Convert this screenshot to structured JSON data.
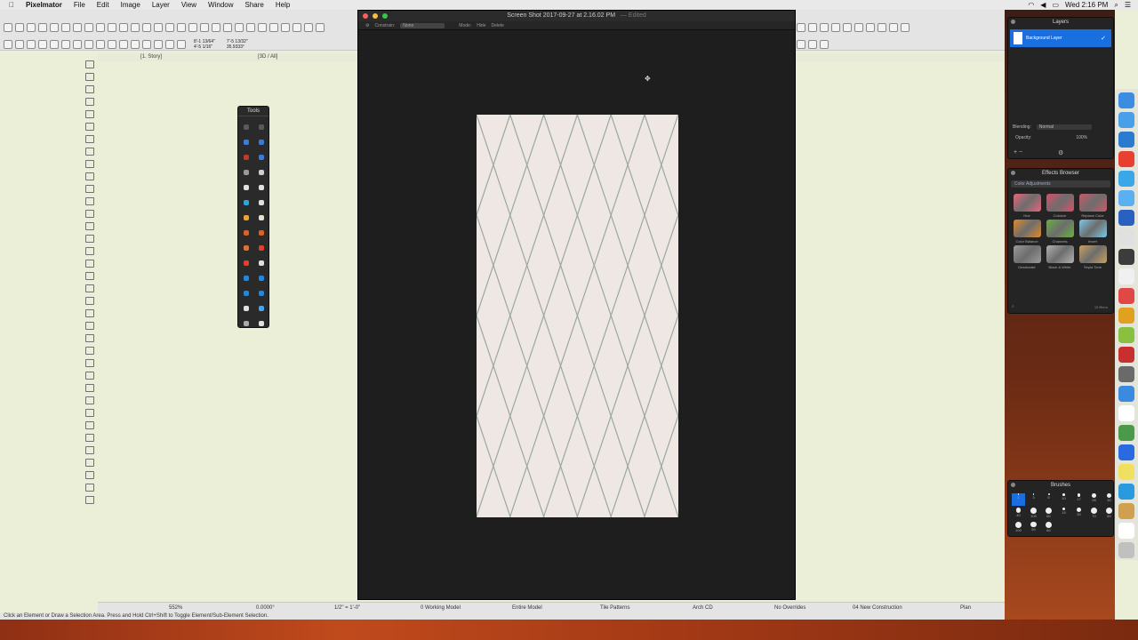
{
  "menubar": {
    "apple": "",
    "app_name": "Pixelmator",
    "menus": [
      "File",
      "Edit",
      "Image",
      "Layer",
      "View",
      "Window",
      "Share",
      "Help"
    ],
    "clock": "Wed 2:16 PM"
  },
  "archicad": {
    "coord_x1": "8'-1 13/64\"",
    "coord_y1": "4'-5 1/16\"",
    "coord_x2": "7'-5 13/32\"",
    "coord_angle": "35.9333°",
    "story_tab": "[1. Story]",
    "view_tab": "[3D / All]",
    "status_text": "Click an Element or Draw a Selection Area. Press and Hold Ctrl+Shift to Toggle Element/Sub-Element Selection.",
    "bottom": {
      "zoom": "552%",
      "angle": "0.0000°",
      "scale": "1/2\" = 1'-0\"",
      "model": "0 Working Model",
      "layer": "Entire Model",
      "pattern": "Tile Patterns",
      "pen": "Arch CD",
      "override": "No Overrides",
      "renovation": "04 New Construction",
      "view": "Plan"
    }
  },
  "tools_palette": {
    "title": "Tools",
    "colors": [
      "#5a5a5a",
      "#5a5a5a",
      "#3a7be0",
      "#3a7be0",
      "#c0392b",
      "#3a7be0",
      "#9a9a9a",
      "#cfcfcf",
      "#e0e0e0",
      "#e0e0e0",
      "#2aa7e0",
      "#e0e0e0",
      "#f0a030",
      "#e8e0d0",
      "#e06020",
      "#e06020",
      "#e07030",
      "#e04030",
      "#e04030",
      "#e0e0e0",
      "#1e88e5",
      "#1e88e5",
      "#1e88e5",
      "#1e88e5",
      "#e0e0e0",
      "#42a5f5",
      "#aaaaaa",
      "#e0e0e0"
    ]
  },
  "pixelmator": {
    "title": "Screen Shot 2017-09-27 at 2.16.02 PM",
    "title_suffix": "— Edited",
    "constrain_label": "Constrain:",
    "constrain_value": "None",
    "mode_label": "Mode:",
    "mode_hide": "Hide",
    "mode_delete": "Delete",
    "canvas_color": "#efe7e4",
    "pattern_color": "#9aa8a0"
  },
  "layers_panel": {
    "title": "Layers",
    "layer_name": "Background Layer",
    "blending_label": "Blending:",
    "blending_value": "Normal",
    "opacity_label": "Opacity:",
    "opacity_value": "100%"
  },
  "effects_panel": {
    "title": "Effects Browser",
    "category": "Color Adjustments",
    "effects": [
      {
        "name": "Hue",
        "color": "#e8657a"
      },
      {
        "name": "Colorize",
        "color": "#d8506a"
      },
      {
        "name": "Replace Color",
        "color": "#c85a68"
      },
      {
        "name": "Color Balance",
        "color": "#e08a2a"
      },
      {
        "name": "Channels",
        "color": "#6ab040"
      },
      {
        "name": "Invert",
        "color": "#7ac8e8"
      },
      {
        "name": "Desaturate",
        "color": "#9a9a9a"
      },
      {
        "name": "Black & White",
        "color": "#b0b0b0"
      },
      {
        "name": "Sepia Tone",
        "color": "#c8a060"
      }
    ],
    "count": "15 filters"
  },
  "brushes_panel": {
    "title": "Brushes",
    "sizes": [
      "1",
      "3",
      "5",
      "10",
      "17",
      "28",
      "30",
      "40",
      "100",
      "60",
      "15",
      "30",
      "70",
      "60",
      "100",
      "50",
      "80"
    ]
  },
  "dock": {
    "colors": [
      "#3a8de0",
      "#4aa0e8",
      "#2a7ad0",
      "#e84030",
      "#3aa8e8",
      "#5ab0f0",
      "#2a60c0",
      "#e0e0e0",
      "#3c3c3c",
      "#f0f0f0",
      "#e04848",
      "#e0a020",
      "#8ac040",
      "#c83030",
      "#6a6a6a",
      "#3a8ae0",
      "#ffffff",
      "#4a9a4a",
      "#2a6ae0",
      "#f0e060",
      "#2a9ae0",
      "#d0a050",
      "#ffffff",
      "#c0c0c0"
    ]
  }
}
